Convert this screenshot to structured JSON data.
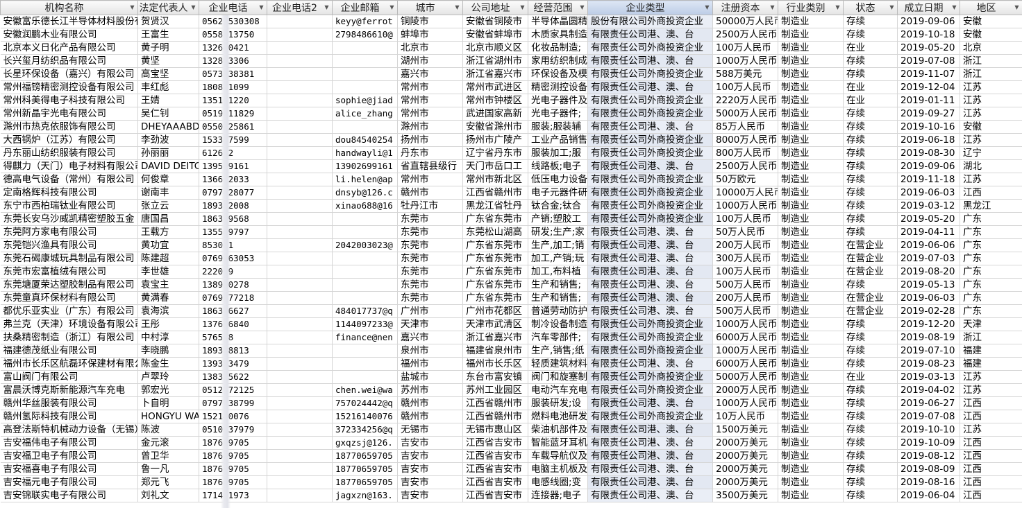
{
  "columns": [
    "机构名称",
    "法定代表人",
    "企业电话",
    "企业电话2",
    "企业邮箱",
    "城市",
    "公司地址",
    "经营范围",
    "企业类型",
    "注册资本",
    "行业类别",
    "状态",
    "成立日期",
    "地区"
  ],
  "rows": [
    [
      "安徽富乐德长江半导体材料股份有限公司",
      "贺贤汉",
      "0562-530308",
      "",
      "keyy@ferrot",
      "铜陵市",
      "安徽省铜陵市",
      "半导体晶圆精",
      "股份有限公司外商投资企业",
      "50000万人民币",
      "制造业",
      "存续",
      "2019-09-06",
      "安徽"
    ],
    [
      "安徽润鹏木业有限公司",
      "王富生",
      "0558313750",
      "",
      "2798486610@",
      "蚌埠市",
      "安徽省蚌埠市",
      "木质家具制造",
      "有限责任公司港、澳、台",
      "2500万人民币",
      "制造业",
      "存续",
      "2019-10-18",
      "安徽"
    ],
    [
      "北京本义日化产品有限公司",
      "黄子明",
      "132640421",
      "",
      "",
      "北京市",
      "北京市顺义区",
      "化妆品制造;",
      "有限责任公司外商投资企业",
      "100万人民币",
      "制造业",
      "在业",
      "2019-05-20",
      "北京"
    ],
    [
      "长兴玺月纺织品有限公司",
      "黄坚",
      "132833306",
      "",
      "",
      "湖州市",
      "浙江省湖州市",
      "家用纺织制成",
      "有限责任公司港、澳、台",
      "1000万人民币",
      "制造业",
      "存续",
      "2019-07-08",
      "浙江"
    ],
    [
      "长星环保设备（嘉兴）有限公司",
      "高宝坚",
      "0573838381",
      "",
      "",
      "嘉兴市",
      "浙江省嘉兴市",
      "环保设备及模",
      "有限责任公司外商投资企业",
      "588万美元",
      "制造业",
      "存续",
      "2019-11-07",
      "浙江"
    ],
    [
      "常州福镑精密测控设备有限公司",
      "丰红彪",
      "180881099",
      "",
      "",
      "常州市",
      "常州市武进区",
      "精密测控设备",
      "有限责任公司港、澳、台",
      "100万人民币",
      "制造业",
      "在业",
      "2019-12-04",
      "江苏"
    ],
    [
      "常州科美得电子科技有限公司",
      "王婧",
      "135121220",
      "",
      "sophie@jiad",
      "常州市",
      "常州市钟楼区",
      "光电子器件及",
      "有限责任公司外商投资企业",
      "2220万人民币",
      "制造业",
      "在业",
      "2019-01-11",
      "江苏"
    ],
    [
      "常州新晶宇光电有限公司",
      "吴仁钊",
      "0519311829",
      "",
      "alice_zhang",
      "常州市",
      "武进国家高新",
      "光电子器件;",
      "有限责任公司外商投资企业",
      "5000万人民币",
      "制造业",
      "存续",
      "2019-09-27",
      "江苏"
    ],
    [
      "滁州市热克依服饰有限公司",
      "DHEYAAABDUL",
      "0550525861",
      "",
      "",
      "滁州市",
      "安徽省滁州市",
      "服装;服装辅",
      "有限责任公司港、澳、台",
      "85万人民币",
      "制造业",
      "存续",
      "2019-10-16",
      "安徽"
    ],
    [
      "大西锅炉（江苏）有限公司",
      "李劲波",
      "153347599",
      "",
      "dou84540254",
      "扬州市",
      "扬州市广陵产",
      "工业产品销售",
      "有限责任公司外商投资企业",
      "8000万人民币",
      "制造业",
      "存续",
      "2019-06-18",
      "江苏"
    ],
    [
      "丹东丽山纺织服装有限公司",
      "孙丽丽",
      "612622",
      "",
      "handwayli@1",
      "丹东市",
      "辽宁省丹东市",
      "服装加工;服",
      "有限责任公司外商投资企业",
      "800万人民币",
      "制造业",
      "存续",
      "2019-08-30",
      "辽宁"
    ],
    [
      "得麒力（天门）电子材料有限公司",
      "DAVID DEITC",
      "139599161",
      "",
      "13902699161",
      "省直辖县级行",
      "天门市岳口工",
      "线路板;电子",
      "有限责任公司港、澳、台",
      "2500万人民币",
      "制造业",
      "存续",
      "2019-09-06",
      "湖北"
    ],
    [
      "德高电气设备（常州）有限公司",
      "何俊章",
      "136612033",
      "",
      "li.helen@ap",
      "常州市",
      "常州市新北区",
      "低压电力设备",
      "有限责任公司外商投资企业",
      "50万欧元",
      "制造业",
      "存续",
      "2019-11-18",
      "江苏"
    ],
    [
      "定南格辉科技有限公司",
      "谢南丰",
      "0797428077",
      "",
      "dnsyb@126.c",
      "赣州市",
      "江西省赣州市",
      "电子元器件研",
      "有限责任公司外商投资企业",
      "10000万人民币",
      "制造业",
      "存续",
      "2019-06-03",
      "江西"
    ],
    [
      "东宁市西柏瑞钛业有限公司",
      "张立云",
      "189332008",
      "",
      "xinao688@16",
      "牡丹江市",
      "黑龙江省牡丹",
      "钛合金;钛合",
      "有限责任公司外商投资企业",
      "1000万人民币",
      "制造业",
      "存续",
      "2019-03-12",
      "黑龙江"
    ],
    [
      "东莞长安乌沙威凯精密塑胶五金",
      "唐国昌",
      "186369568",
      "",
      "",
      "东莞市",
      "广东省东莞市",
      "产销;塑胶工",
      "有限责任公司外商投资企业",
      "100万人民币",
      "制造业",
      "存续",
      "2019-05-20",
      "广东"
    ],
    [
      "东莞阿方家电有限公司",
      "王载方",
      "135549797",
      "",
      "",
      "东莞市",
      "东莞松山湖高",
      "研发;生产;家",
      "有限责任公司港、澳、台",
      "50万人民币",
      "制造业",
      "存续",
      "2019-04-11",
      "广东"
    ],
    [
      "东莞铠兴渔具有限公司",
      "黄功宜",
      "853001",
      "",
      "2042003023@",
      "东莞市",
      "广东省东莞市",
      "生产,加工;销",
      "有限责任公司港、澳、台",
      "200万人民币",
      "制造业",
      "在营企业",
      "2019-06-06",
      "广东"
    ],
    [
      "东莞石碣康城玩具制品有限公司",
      "陈建超",
      "0769363053",
      "",
      "",
      "东莞市",
      "广东省东莞市",
      "加工,产销;玩",
      "有限责任公司港、澳、台",
      "300万人民币",
      "制造业",
      "在营企业",
      "2019-07-03",
      "广东"
    ],
    [
      "东莞市宏富植绒有限公司",
      "李世雄",
      "222009",
      "",
      "",
      "东莞市",
      "广东省东莞市",
      "加工,布料植",
      "有限责任公司港、澳、台",
      "100万人民币",
      "制造业",
      "在营企业",
      "2019-08-20",
      "广东"
    ],
    [
      "东莞塘厦荣达塑胶制品有限公司",
      "袁宝主",
      "138990278",
      "",
      "",
      "东莞市",
      "广东省东莞市",
      "生产和销售;",
      "有限责任公司港、澳、台",
      "500万人民币",
      "制造业",
      "存续",
      "2019-05-13",
      "广东"
    ],
    [
      "东莞童真环保材料有限公司",
      "黄满春",
      "0769377218",
      "",
      "",
      "东莞市",
      "广东省东莞市",
      "生产和销售;",
      "有限责任公司港、澳、台",
      "200万人民币",
      "制造业",
      "在营企业",
      "2019-06-03",
      "广东"
    ],
    [
      "都优乐亚实业（广东）有限公司",
      "袁海滨",
      "186376627",
      "",
      "484017737@q",
      "广州市",
      "广州市花都区",
      "普通劳动防护",
      "有限责任公司港、澳、台",
      "500万人民币",
      "制造业",
      "在营企业",
      "2019-02-28",
      "广东"
    ],
    [
      "弗兰克（天津）环境设备有限公司",
      "王彤",
      "137616840",
      "",
      "1144097233@",
      "天津市",
      "天津市武清区",
      "制冷设备制造",
      "有限责任公司外商投资企业",
      "1000万人民币",
      "制造业",
      "存续",
      "2019-12-20",
      "天津"
    ],
    [
      "扶桑精密制造（浙江）有限公司",
      "中村淳",
      "576598",
      "",
      "finance@nen",
      "嘉兴市",
      "浙江省嘉兴市",
      "汽车零部件;",
      "有限责任公司外商投资企业",
      "6000万人民币",
      "制造业",
      "存续",
      "2019-08-19",
      "浙江"
    ],
    [
      "福建德茂纸业有限公司",
      "李晓鹏",
      "189338813",
      "",
      "",
      "泉州市",
      "福建省泉州市",
      "生产,销售;纸",
      "有限责任公司外商投资企业",
      "1000万人民币",
      "制造业",
      "存续",
      "2019-07-10",
      "福建"
    ],
    [
      "福州市长乐区航磊环保建材有限公司",
      "陈金生",
      "139323479",
      "",
      "",
      "福州市",
      "福州市长乐区",
      "轻质建筑材料",
      "有限责任公司港、澳、台",
      "6000万人民币",
      "制造业",
      "存续",
      "2019-08-23",
      "福建"
    ],
    [
      "富山阀门有限公司",
      "卢翠玲",
      "138325622",
      "",
      "",
      "盐城市",
      "东台市富安镇",
      "阀门和旋塞制",
      "有限责任公司外商投资企业",
      "5000万人民币",
      "制造业",
      "在业",
      "2019-03-13",
      "江苏"
    ],
    [
      "富晨沃博克斯新能源汽车充电",
      "郭宏光",
      "0512672125",
      "",
      "chen.wei@wa",
      "苏州市",
      "苏州工业园区",
      "电动汽车充电",
      "有限责任公司外商投资企业",
      "2000万人民币",
      "制造业",
      "存续",
      "2019-04-02",
      "江苏"
    ],
    [
      "赣州华丝服装有限公司",
      "卜自明",
      "0797638799",
      "",
      "757024442@q",
      "赣州市",
      "江西省赣州市",
      "服装研发;设",
      "有限责任公司港、澳、台",
      "1000万人民币",
      "制造业",
      "存续",
      "2019-06-27",
      "江西"
    ],
    [
      "赣州氢际科技有限公司",
      "HONGYU WANG",
      "152140076",
      "",
      "15216140076",
      "赣州市",
      "江西省赣州市",
      "燃料电池研发",
      "有限责任公司外商投资企业",
      "10万人民币",
      "制造业",
      "存续",
      "2019-07-08",
      "江西"
    ],
    [
      "高登法斯特机械动力设备（无锡）",
      "陈波",
      "0510937979",
      "",
      "372334256@q",
      "无锡市",
      "无锡市惠山区",
      "柴油机部件及",
      "有限责任公司港、澳、台",
      "1500万美元",
      "制造业",
      "存续",
      "2019-10-10",
      "江苏"
    ],
    [
      "吉安福伟电子有限公司",
      "金元滚",
      "187659705",
      "",
      "gxqzsj@126.",
      "吉安市",
      "江西省吉安市",
      "智能蓝牙耳机",
      "有限责任公司港、澳、台",
      "2000万美元",
      "制造业",
      "存续",
      "2019-10-09",
      "江西"
    ],
    [
      "吉安福卫电子有限公司",
      "曾卫华",
      "187659705",
      "",
      "18770659705",
      "吉安市",
      "江西省吉安市",
      "车载导航仪及",
      "有限责任公司港、澳、台",
      "2000万美元",
      "制造业",
      "存续",
      "2019-08-12",
      "江西"
    ],
    [
      "吉安福喜电子有限公司",
      "鲁一凡",
      "187659705",
      "",
      "18770659705",
      "吉安市",
      "江西省吉安市",
      "电脑主机板及",
      "有限责任公司港、澳、台",
      "2000万美元",
      "制造业",
      "存续",
      "2019-08-09",
      "江西"
    ],
    [
      "吉安福元电子有限公司",
      "郑元飞",
      "187659705",
      "",
      "18770659705",
      "吉安市",
      "江西省吉安市",
      "电感线圈;变",
      "有限责任公司港、澳、台",
      "2000万美元",
      "制造业",
      "存续",
      "2019-08-16",
      "江西"
    ],
    [
      "吉安锦联实电子有限公司",
      "刘礼文",
      "171401973",
      "",
      "jagxzn@163.",
      "吉安市",
      "江西省吉安市",
      "连接器;电子",
      "有限责任公司港、澳、台",
      "3500万美元",
      "制造业",
      "存续",
      "2019-06-04",
      "江西"
    ]
  ]
}
